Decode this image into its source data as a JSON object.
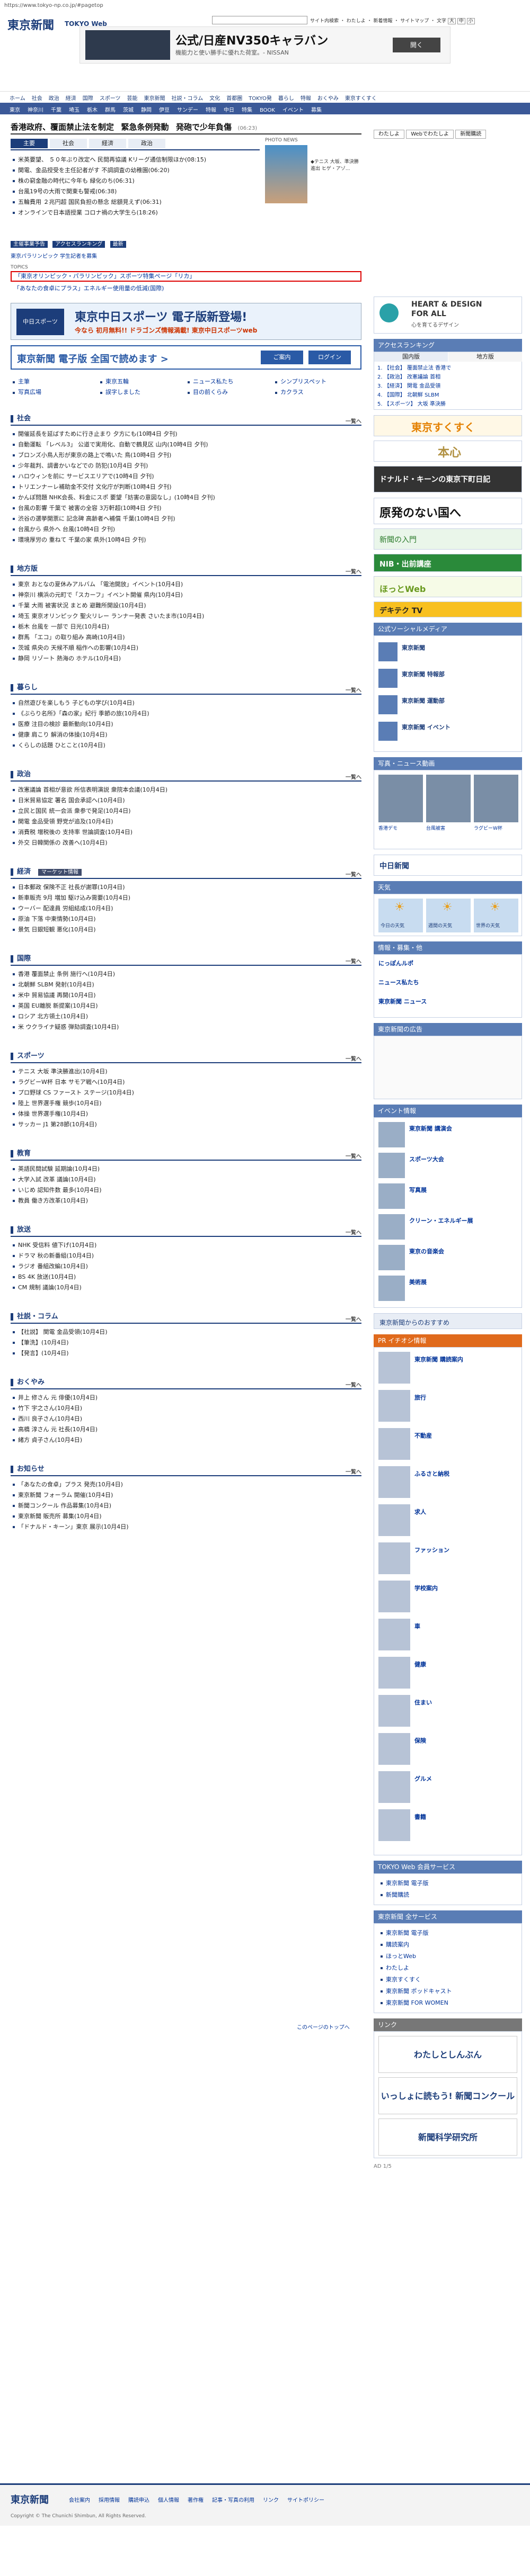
{
  "browser": {
    "url": "https://www.tokyo-np.co.jp/#pagetop"
  },
  "header": {
    "logo": "東京新聞",
    "web": "TOKYO Web",
    "links": [
      "サイト内検索",
      "わたしよ",
      "新着情報",
      "サイトマップ",
      "文字"
    ],
    "size_labels": [
      "大",
      "中",
      "小"
    ],
    "ad": {
      "brand": "公式/日産NV350キャラバン",
      "sub": "機能力と使い勝手に優れた荷室。- NISSAN",
      "open": "開く"
    }
  },
  "nav": {
    "main": [
      "ホーム",
      "社会",
      "政治",
      "経済",
      "国際",
      "スポーツ",
      "芸能",
      "東京新聞",
      "社説・コラム",
      "文化",
      "首都圏",
      "TOKYO発",
      "暮らし",
      "特報",
      "おくやみ",
      "東京すくすく"
    ],
    "sub": [
      "東京",
      "神奈川",
      "千葉",
      "埼玉",
      "栃木",
      "群馬",
      "茨城",
      "静岡",
      "伊豆",
      "サンデー",
      "特報",
      "中日",
      "特集",
      "BOOK",
      "イベント",
      "募集"
    ]
  },
  "hero": {
    "tags": [
      "香港政府、覆面禁止法を制定",
      "緊急条例発動",
      "発砲で少年負傷"
    ],
    "time": "(06:23)",
    "tabs": [
      "主要",
      "社会",
      "経済",
      "政治"
    ],
    "news": [
      "米英要望、 ５０年ぶり改定へ 民間再協議 Kリーグ通信制限ほか(08:15)",
      "関電、金品授受を主任記者がす 不調調査の幼稚園(06:20)",
      "株の窮金融の時代に今年も 緑化のち(06:31)",
      "台風19号の大雨で関東も警戒(06:38)",
      "五輪費用 ２兆円超 国民負担の懸念 総額見えず(06:31)",
      "オンラインで日本語授業 コロナ禍の大学生ら(18:26)"
    ],
    "photo_label": "PHOTO NEWS",
    "photo_caption": "◆テニス 大坂、準決勝進出 ヒゲ・アゾ...",
    "mid_links": [
      "主催事業予告",
      "アクセスランキング",
      "最新",
      "東京パラリンピック 学生記者を募集"
    ],
    "red_box": "「東京オリンピック・パラリンピック」スポーツ特集ページ「リカ」",
    "red_sub": "「あなたの食卓にプラス」エネルギー使用量の低減(国際)",
    "topics_title": "TOPICS"
  },
  "banners": {
    "chunichi": {
      "left": "中日スポーツ",
      "main": "東京中日スポーツ 電子版新登場!",
      "sub": "今なら 初月無料!! ドラゴンズ情報満載! 東京中日スポーツweb"
    },
    "digital": {
      "text": "東京新聞 電子版 全国で読めます >",
      "guide": "ご案内",
      "login": "ログイン"
    }
  },
  "quick": [
    "主筆",
    "東京五輪",
    "ニュース私たち",
    "シンプリスペット",
    "写真広場",
    "誤字しました",
    "目の前くらみ",
    "カクラス"
  ],
  "sections": [
    {
      "title": "社会",
      "more": "一覧へ",
      "items": [
        "開催延長を延ばすために行き止まり 夕方にも(10時4日 夕刊)",
        "自動運転 「レベル3」 公道で実用化、自動で鶴見区 山内(10時4日 夕刊)",
        "ブロンズ小鳥人形が東京の路上で鳴いた 鳥(10時4日 夕刊)",
        "少年裁判、調書かいなどでの 防犯(10月4日 夕刊)",
        "ハロウィンを前に サービスエリアで(10時4日 夕刊)",
        "トリエンナーレ補助金不交付 文化庁が判断(10時4日 夕刊)",
        "かんぽ問題 NHK会長、料金にスポ 要望「妨害の意図なし」(10時4日 夕刊)",
        "台風の影響 千葉で 被害の全容 3万軒超(10時4日 夕刊)",
        "渋谷の選挙開票に 記念碑 高齢者へ補償 千葉(10時4日 夕刊)",
        "台風から 県外へ 台風(10時4日 夕刊)",
        "環境厚労の 重ねて 千葉の家 県外(10時4日 夕刊)"
      ]
    },
    {
      "title": "地方版",
      "more": "一覧へ",
      "items": [
        "東京 おとなの夏休みアルバム 「電池開放」イベント(10月4日)",
        "神奈川 横浜の元町で「スカーフ」イベント開催 県内(10月4日)",
        "千葉 大雨 被害状況 まとめ 避難所開設(10月4日)",
        "埼玉 東京オリンピック 聖火リレー ランナー発表 さいたま市(10月4日)",
        "栃木 台風を 一部で 日光(10月4日)",
        "群馬 「エコ」の取り組み 高崎(10月4日)",
        "茨城 県央の 天候不順 稲作への影響(10月4日)",
        "静岡 リゾート 熱海の ホテル(10月4日)"
      ]
    },
    {
      "title": "暮らし",
      "more": "一覧へ",
      "items": [
        "自然遊びを楽しもう 子どもの学び(10月4日)",
        "《ぶらり名所》「森の家」紀行 季節の旅(10月4日)",
        "医療 注目の検診 最新動向(10月4日)",
        "健康 肩こり 解消の体操(10月4日)",
        "くらしの話題 ひとこと(10月4日)"
      ]
    },
    {
      "title": "政治",
      "more": "一覧へ",
      "items": [
        "改憲議論 首相が意欲 所信表明演説 衆院本会議(10月4日)",
        "日米貿易協定 署名 国会承認へ(10月4日)",
        "立民と国民 統一会派 衆参で発足(10月4日)",
        "関電 金品受領 野党が追及(10月4日)",
        "消費税 増税後の 支持率 世論調査(10月4日)",
        "外交 日韓関係の 改善へ(10月4日)"
      ]
    },
    {
      "title": "経済",
      "tag": "マーケット情報",
      "more": "一覧へ",
      "items": [
        "日本郵政 保険不正 社長が謝罪(10月4日)",
        "新車販売 9月 増加 駆け込み需要(10月4日)",
        "ウーバー 配達員 労組結成(10月4日)",
        "原油 下落 中東情勢(10月4日)",
        "景気 日銀短観 悪化(10月4日)"
      ]
    },
    {
      "title": "国際",
      "more": "一覧へ",
      "items": [
        "香港 覆面禁止 条例 施行へ(10月4日)",
        "北朝鮮 SLBM 発射(10月4日)",
        "米中 貿易協議 再開(10月4日)",
        "英国 EU離脱 新提案(10月4日)",
        "ロシア 北方領土(10月4日)",
        "米 ウクライナ疑惑 弾劾調査(10月4日)"
      ]
    },
    {
      "title": "スポーツ",
      "more": "一覧へ",
      "items": [
        "テニス 大坂 準決勝進出(10月4日)",
        "ラグビーW杯 日本 サモア戦へ(10月4日)",
        "プロ野球 CS ファースト ステージ(10月4日)",
        "陸上 世界選手権 競歩(10月4日)",
        "体操 世界選手権(10月4日)",
        "サッカー J1 第28節(10月4日)"
      ]
    },
    {
      "title": "教育",
      "more": "一覧へ",
      "items": [
        "英語民間試験 延期論(10月4日)",
        "大学入試 改革 議論(10月4日)",
        "いじめ 認知件数 最多(10月4日)",
        "教員 働き方改革(10月4日)"
      ]
    },
    {
      "title": "放送",
      "more": "一覧へ",
      "items": [
        "NHK 受信料 値下げ(10月4日)",
        "ドラマ 秋の新番組(10月4日)",
        "ラジオ 番組改編(10月4日)",
        "BS 4K 放送(10月4日)",
        "CM 規制 議論(10月4日)"
      ]
    },
    {
      "title": "社説・コラム",
      "more": "一覧へ",
      "items": [
        "【社説】 関電 金品受領(10月4日)",
        "【筆洗】(10月4日)",
        "【発言】(10月4日)"
      ]
    },
    {
      "title": "おくやみ",
      "more": "一覧へ",
      "items": [
        "井上 修さん 元 俳優(10月4日)",
        "竹下 宇之さん(10月4日)",
        "西川 良子さん(10月4日)",
        "高橋 淳さん 元 社長(10月4日)",
        "緒方 貞子さん(10月4日)"
      ]
    },
    {
      "title": "お知らせ",
      "more": "一覧へ",
      "items": [
        "「あなたの食卓」プラス 発売(10月4日)",
        "東京新聞 フォーラム 開催(10月4日)",
        "新聞コンクール 作品募集(10月4日)",
        "東京新聞 販売所 募集(10月4日)",
        "「ドナルド・キーン」東京 展示(10月4日)"
      ]
    }
  ],
  "back_to_top": "このページのトップへ",
  "side": {
    "links": [
      "わたしよ",
      "Webでわたしよ",
      "新聞購読"
    ],
    "heart_design": [
      "HEART & DESIGN",
      "FOR ALL",
      "心を育てるデザイン"
    ],
    "ranking_title": "アクセスランキング",
    "ranking_tabs": [
      "国内版",
      "地方版"
    ],
    "ranking": [
      "【社会】 覆面禁止法 香港で",
      "【政治】 改憲議論 首相",
      "【経済】 関電 金品受領",
      "【国際】 北朝鮮 SLBM",
      "【スポーツ】 大坂 準決勝"
    ],
    "sukusuku": "東京すくすく",
    "honmaru": "本心",
    "keene": "ドナルド・キーンの東京下町日記",
    "genpatsu": "原発のない国へ",
    "shinbun_no": "新聞の入門",
    "nib": "NIB・出前講座",
    "hot": "ほっとWeb",
    "dekitoku": "デキテク TV",
    "sns_title": "公式ソーシャルメディア",
    "sns": [
      "東京新聞",
      "東京新聞 特報部",
      "東京新聞 運動部",
      "東京新聞 イベント"
    ],
    "photo_title": "写真・ニュース動画",
    "photo_items": [
      "香港デモ",
      "台風被害",
      "ラグビーW杯"
    ],
    "chunichi_tokyo": "中日新聞",
    "weather_title": "天気",
    "weather": [
      "今日の天気",
      "週間の天気",
      "世界の天気"
    ],
    "misc_title": "情報・募集・他",
    "misc": [
      "にっぽんルポ",
      "ニュース私たち",
      "東京新聞 ニュース"
    ],
    "ad_title": "東京新聞の広告",
    "event_title": "イベント情報",
    "events": [
      "東京新聞 講演会",
      "スポーツ大会",
      "写真展",
      "クリーン・エネルギー展",
      "東京の音楽会",
      "美術展"
    ],
    "shinbun_rec": "東京新聞からのおすすめ",
    "pr_title": "PR イチオシ情報",
    "pr": [
      "東京新聞 購読案内",
      "旅行",
      "不動産",
      "ふるさと納税",
      "求人",
      "ファッション",
      "学校案内",
      "車",
      "健康",
      "住まい",
      "保険",
      "グルメ",
      "書籍"
    ],
    "tokyo_web": "TOKYO Web 会員サービス",
    "web_links": [
      "東京新聞 電子版",
      "新聞購読"
    ],
    "all_services": "東京新聞 全サービス",
    "services": [
      "東京新聞 電子版",
      "購読案内",
      "ほっとWeb",
      "わたしよ",
      "東京すくすく",
      "東京新聞 ポッドキャスト",
      "東京新聞 FOR WOMEN"
    ],
    "link_title": "リンク",
    "links_foot": [
      "わたしとしんぶん",
      "いっしょに読もう! 新聞コンクール",
      "新聞科学研究所"
    ],
    "ad_count": "AD 1/5"
  },
  "footer": {
    "logo": "東京新聞",
    "links": [
      "会社案内",
      "採用情報",
      "購読申込",
      "個人情報",
      "著作権",
      "記事・写真の利用",
      "リンク",
      "サイトポリシー"
    ],
    "copyright": "Copyright © The Chunichi Shimbun, All Rights Reserved."
  }
}
